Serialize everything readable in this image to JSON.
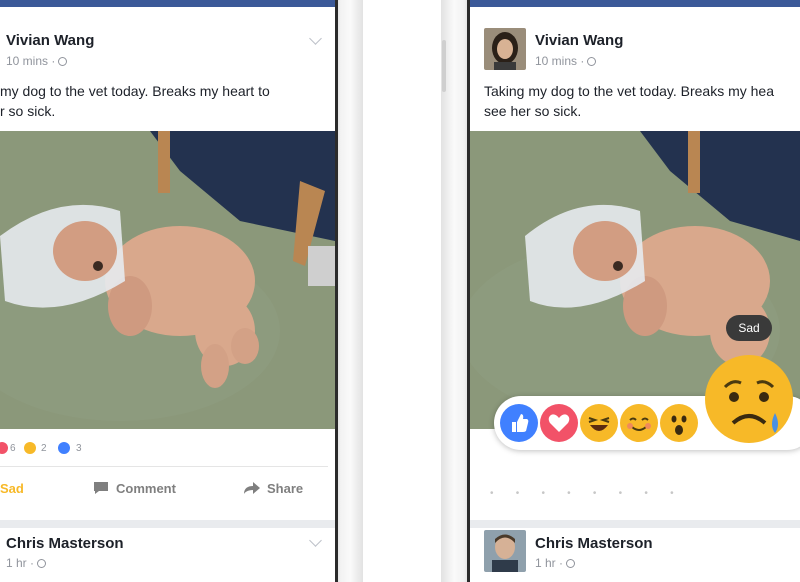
{
  "left_phone": {
    "post1": {
      "author": "Vivian Wang",
      "time": "10 mins ·",
      "caption_line1": "my dog to the vet today. Breaks my heart to",
      "caption_line2": "r so sick."
    },
    "reactions": {
      "love_count": "6",
      "sad_count": "2",
      "comment_count": "3"
    },
    "actions": {
      "sad_label": "Sad",
      "comment_label": "Comment",
      "share_label": "Share"
    },
    "post2": {
      "author": "Chris Masterson",
      "time": "1 hr ·"
    }
  },
  "right_phone": {
    "post1": {
      "author": "Vivian Wang",
      "time": "10 mins ·",
      "caption_line1": "Taking my dog to the vet today. Breaks my hea",
      "caption_line2": "see her so sick."
    },
    "reaction_picker": {
      "tooltip": "Sad",
      "options": [
        "like-icon",
        "love-icon",
        "haha-icon",
        "yay-icon",
        "wow-icon",
        "sad-icon"
      ]
    },
    "post2": {
      "author": "Chris Masterson",
      "time": "1 hr ·"
    }
  },
  "colors": {
    "facebook_blue": "#3b5998",
    "sad_yellow": "#f7b928",
    "love_red": "#f25268",
    "like_blue": "#4080ff"
  }
}
